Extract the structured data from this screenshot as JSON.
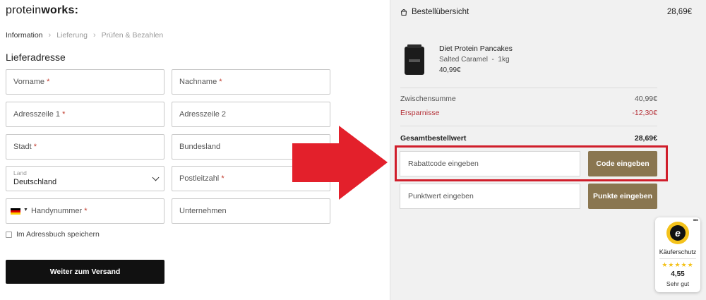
{
  "brand": {
    "logo_light": "protein",
    "logo_bold": "works",
    "logo_colon": ":"
  },
  "breadcrumb": {
    "items": [
      "Information",
      "Lieferung",
      "Prüfen & Bezahlen"
    ],
    "separator": "›"
  },
  "form": {
    "section_title": "Lieferadresse",
    "required_marker": "*",
    "fields": {
      "first_name": "Vorname",
      "last_name": "Nachname",
      "address1": "Adresszeile 1",
      "address2": "Adresszeile 2",
      "city": "Stadt",
      "state": "Bundesland",
      "country_label": "Land",
      "country_value": "Deutschland",
      "zip": "Postleitzahl",
      "phone": "Handynummer",
      "company": "Unternehmen"
    },
    "save_address_label": "Im Adressbuch speichern",
    "continue_button": "Weiter zum Versand"
  },
  "summary": {
    "title": "Bestellübersicht",
    "header_total": "28,69€",
    "product": {
      "name": "Diet Protein Pancakes",
      "variant": "Salted Caramel",
      "variant_sep": "-",
      "size": "1kg",
      "price": "40,99€"
    },
    "subtotal_label": "Zwischensumme",
    "subtotal_value": "40,99€",
    "savings_label": "Ersparnisse",
    "savings_value": "-12,30€",
    "total_label": "Gesamtbestellwert",
    "total_value": "28,69€",
    "discount_placeholder": "Rabattcode eingeben",
    "discount_button": "Code eingeben",
    "points_placeholder": "Punktwert eingeben",
    "points_button": "Punkte eingeben"
  },
  "trusted_shops": {
    "menu": "•••",
    "seal_letter": "e",
    "label": "Käuferschutz",
    "stars": "★★★★★",
    "score": "4,55",
    "rating_text": "Sehr gut"
  },
  "colors": {
    "accent_gold": "#8a7650",
    "savings_red": "#b5333a",
    "highlight_red": "#d01e2b",
    "arrow_red": "#e3202b",
    "primary_button": "#111111"
  },
  "icons": {
    "bag": "shopping-bag-icon",
    "chevron": "chevron-down-icon",
    "flag": "germany-flag-icon",
    "arrow": "red-arrow-icon"
  }
}
